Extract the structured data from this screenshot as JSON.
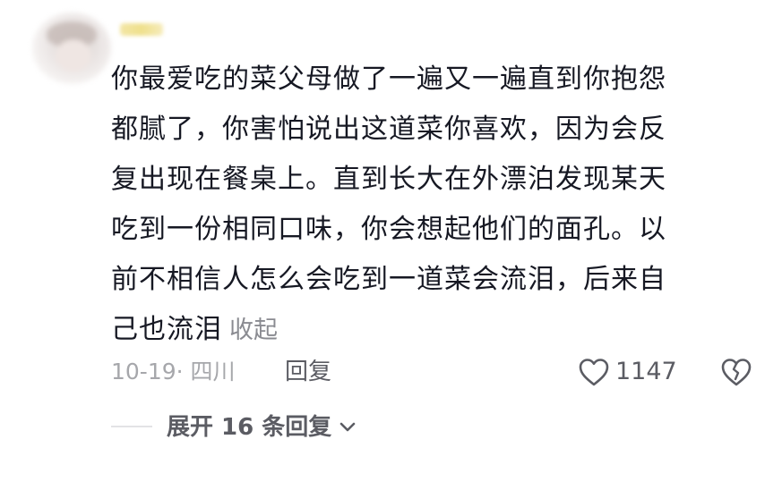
{
  "comment": {
    "avatar_icon": "user-avatar",
    "text_lines": [
      "你最爱吃的菜父母做了一遍又一遍直到你抱怨",
      "都腻了，你害怕说出这道菜你喜欢，因为会反",
      "复出现在餐桌上。直到长大在外漂泊发现某天",
      "吃到一份相同口味，你会想起他们的面孔。以",
      "前不相信人怎么会吃到一道菜会流泪，后来自",
      "己也流泪"
    ],
    "collapse_label": "收起",
    "date_location": "10-19· 四川",
    "reply_label": "回复",
    "like_icon": "heart-outline-icon",
    "like_count": "1147",
    "dislike_icon": "broken-heart-icon",
    "expand_replies_label": "展开 16 条回复",
    "expand_icon": "chevron-down-icon",
    "colors": {
      "text_primary": "#161823",
      "text_secondary": "#5b5c63",
      "text_muted": "#a6a7ab",
      "collapse_link": "#8a8b91"
    }
  }
}
